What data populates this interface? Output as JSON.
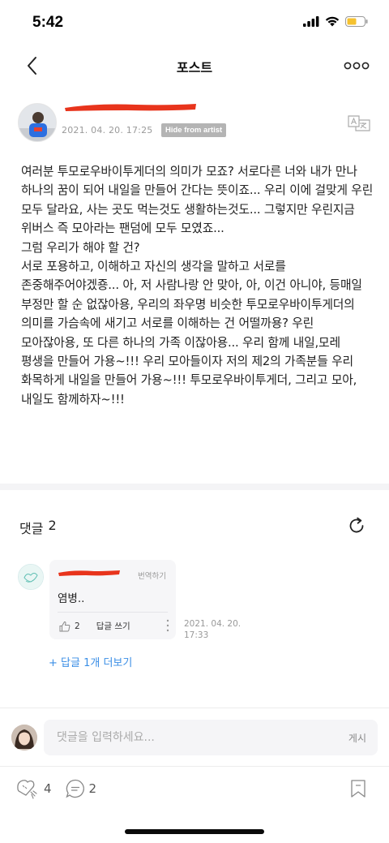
{
  "status_bar": {
    "time": "5:42"
  },
  "nav": {
    "title": "포스트"
  },
  "post": {
    "date": "2021. 04. 20. 17:25",
    "badge": "Hide from artist",
    "body": "여러분 투모로우바이투게더의 의미가 모죠? 서로다른 너와 내가 만나 하나의 꿈이 되어 내일을 만들어 간다는 뜻이죠... 우리 이에 걸맞게 우린 모두 달라요, 사는 곳도 먹는것도 생활하는것도... 그렇지만 우린지금 위버스 즉 모아라는 팬덤에 모두 모였죠...\n그럼 우리가 해야 할 건?\n서로 포용하고, 이해하고 자신의 생각을 말하고 서로를 존중해주어야겠죵... 아, 저 사람나랑 안 맞아, 아, 이건 아니야, 등매일 부정만 할 순 없잖아용, 우리의 좌우명 비슷한 투모로우바이투게더의 의미를 가슴속에 새기고 서로를 이해하는 건 어떨까용? 우린 모아잖아용, 또 다른 하나의 가족 이잖아용... 우리 함께 내일,모레 평생을 만들어 가용~!!! 우리 모아들이자 저의 제2의 가족분들 우리 화목하게 내일을 만들어 가용~!!! 투모로우바이투게더, 그리고 모아, 내일도 함께하자~!!!"
  },
  "comments": {
    "label": "댓글",
    "count": "2",
    "items": [
      {
        "translate": "번역하기",
        "text": "염병..",
        "likes": "2",
        "reply_label": "답글 쓰기",
        "date": "2021. 04. 20.\n17:33"
      }
    ],
    "more_replies": "+ 답글 1개 더보기"
  },
  "input": {
    "placeholder": "댓글을 입력하세요...",
    "submit": "게시"
  },
  "bottom": {
    "likes": "4",
    "comments": "2"
  },
  "colors": {
    "accent": "#3a8ee6",
    "redaction": "#e8341c",
    "badge": "#b4b4b4"
  }
}
